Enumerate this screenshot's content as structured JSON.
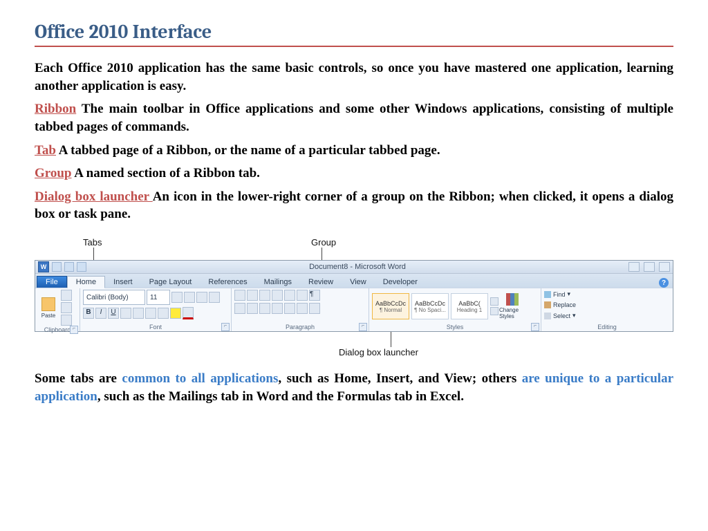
{
  "title": "Office 2010 Interface",
  "intro": "Each Office 2010 application has the same basic controls, so once you have mastered one application, learning another application is easy.",
  "defs": {
    "ribbon_term": "Ribbon",
    "ribbon_text": " The main toolbar in Office applications and some other Windows applications, consisting of multiple tabbed pages of commands.",
    "tab_term": "Tab",
    "tab_text": " A tabbed page of a Ribbon, or the name of a particular tabbed page.",
    "group_term": "Group",
    "group_text": " A named section of a Ribbon tab.",
    "dbl_term": "Dialog box launcher ",
    "dbl_text": "An icon in the lower-right corner of a group on the Ribbon; when clicked, it opens a dialog box or task pane."
  },
  "callouts": {
    "tabs": "Tabs",
    "group": "Group",
    "dialog": "Dialog box launcher"
  },
  "word": {
    "app_icon": "W",
    "doc_title": "Document8 - Microsoft Word",
    "tabs": {
      "file": "File",
      "home": "Home",
      "insert": "Insert",
      "page_layout": "Page Layout",
      "references": "References",
      "mailings": "Mailings",
      "review": "Review",
      "view": "View",
      "developer": "Developer"
    },
    "help": "?",
    "groups": {
      "clipboard": "Clipboard",
      "font": "Font",
      "paragraph": "Paragraph",
      "styles": "Styles",
      "editing": "Editing"
    },
    "paste": "Paste",
    "font_name": "Calibri (Body)",
    "font_size": "11",
    "style_sample": "AaBbCcDc",
    "style_sample_big": "AaBbC(",
    "style_normal": "¶ Normal",
    "style_nospace": "¶ No Spaci...",
    "style_heading": "Heading 1",
    "change_styles": "Change Styles",
    "find": "Find",
    "replace": "Replace",
    "select": "Select"
  },
  "footer": {
    "p1a": "Some tabs are ",
    "p1b": "common to all applications",
    "p1c": ", such as Home, Insert, and View; others ",
    "p1d": "are unique to a particular application",
    "p1e": ", such as the Mailings tab in Word and the Formulas tab in Excel."
  }
}
